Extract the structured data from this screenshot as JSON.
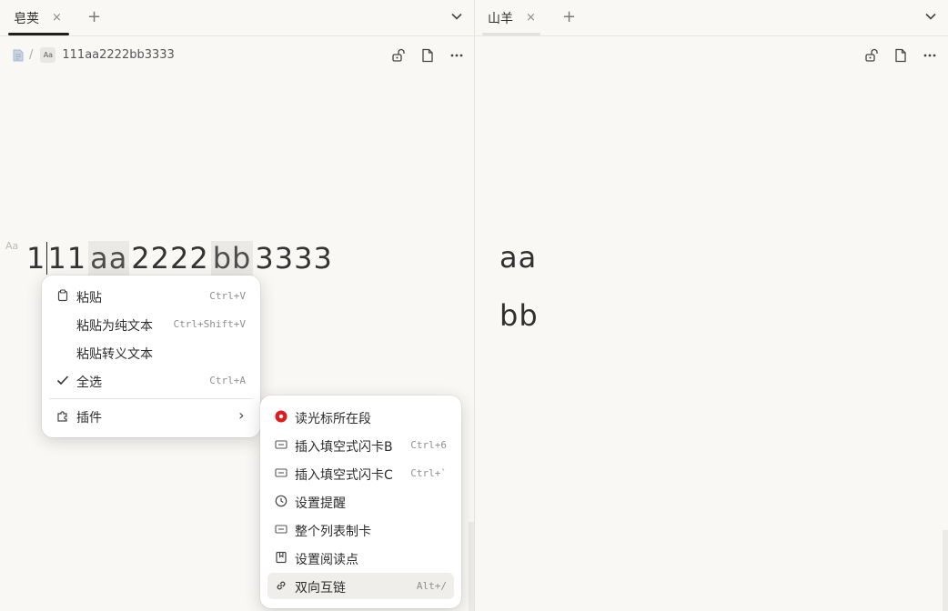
{
  "left_pane": {
    "tab": {
      "title": "皂荚",
      "close": "×",
      "underline_color": "#1f1f1f"
    },
    "tab_add": "+",
    "breadcrumb": {
      "sep": "/",
      "aa": "Aa",
      "doc": "111aa2222bb3333"
    },
    "block_marker": "Aa",
    "heading": {
      "p1": "1",
      "p2": "11",
      "m1": "aa",
      "p3": "2222",
      "m2": "bb",
      "p4": "3333"
    }
  },
  "right_pane": {
    "tab": {
      "title": "山羊",
      "close": "×",
      "underline_color": "#e3e1dd"
    },
    "tab_add": "+",
    "lines": [
      "aa",
      "bb"
    ]
  },
  "context_menu": {
    "items": [
      {
        "icon": "clipboard-icon",
        "label": "粘贴",
        "shortcut": "Ctrl+V"
      },
      {
        "icon": "",
        "label": "粘贴为纯文本",
        "shortcut": "Ctrl+Shift+V"
      },
      {
        "icon": "",
        "label": "粘贴转义文本",
        "shortcut": ""
      },
      {
        "icon": "check-icon",
        "label": "全选",
        "shortcut": "Ctrl+A"
      }
    ],
    "plugins": {
      "icon": "puzzle-icon",
      "label": "插件",
      "arrow": "›"
    }
  },
  "plugin_submenu": {
    "items": [
      {
        "icon": "red-dot-icon",
        "label": "读光标所在段",
        "shortcut": ""
      },
      {
        "icon": "flashcard-icon",
        "label": "插入填空式闪卡B",
        "shortcut": "Ctrl+6"
      },
      {
        "icon": "flashcard-icon",
        "label": "插入填空式闪卡C",
        "shortcut": "Ctrl+`"
      },
      {
        "icon": "clock-icon",
        "label": "设置提醒",
        "shortcut": ""
      },
      {
        "icon": "flashcard-icon",
        "label": "整个列表制卡",
        "shortcut": ""
      },
      {
        "icon": "bookmark-icon",
        "label": "设置阅读点",
        "shortcut": ""
      },
      {
        "icon": "link-icon",
        "label": "双向互链",
        "shortcut": "Alt+/"
      }
    ],
    "highlighted_index": 6,
    "accent": "#e01b1b"
  }
}
